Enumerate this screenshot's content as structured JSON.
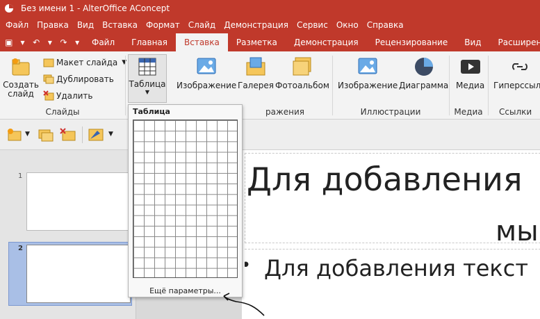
{
  "window": {
    "title": "Без имени 1 - AlterOffice AConcept"
  },
  "menu": [
    "Файл",
    "Правка",
    "Вид",
    "Вставка",
    "Формат",
    "Слайд",
    "Демонстрация",
    "Сервис",
    "Окно",
    "Справка"
  ],
  "tabs": [
    "Файл",
    "Главная",
    "Вставка",
    "Разметка",
    "Демонстрация",
    "Рецензирование",
    "Вид",
    "Расширение"
  ],
  "active_tab": "Вставка",
  "ribbon": {
    "slides": {
      "create": "Создать\nслайд",
      "layout": "Макет слайда",
      "duplicate": "Дублировать",
      "delete": "Удалить",
      "label": "Слайды"
    },
    "table": {
      "label": "Таблица"
    },
    "images": {
      "image": "Изображение",
      "gallery": "Галерея",
      "photoalbum": "Фотоальбом",
      "label": "ражения"
    },
    "illustrations": {
      "image": "Изображение",
      "chart": "Диаграмма",
      "label": "Иллюстрации"
    },
    "media": {
      "media": "Медиа",
      "label": "Медиа"
    },
    "links": {
      "hyperlink": "Гиперссылк",
      "label": "Ссылки"
    }
  },
  "slides_panel": {
    "items": [
      "1",
      "2"
    ]
  },
  "slide_content": {
    "title_line1": "Для добавления",
    "title_line2": "мы",
    "bullet": "Для добавления текст"
  },
  "table_popup": {
    "title": "Таблица",
    "more": "Ещё параметры..."
  },
  "colors": {
    "accent": "#c0392b",
    "ribbon_bg": "#f3f3f3",
    "slide_selected": "#a9bfe6"
  }
}
